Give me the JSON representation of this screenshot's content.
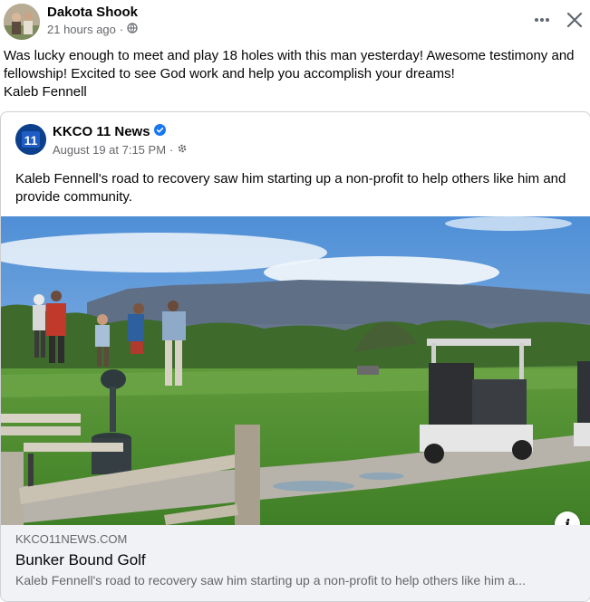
{
  "post": {
    "author": "Dakota Shook",
    "timestamp": "21 hours ago",
    "separator": "·",
    "privacy_icon": "globe-icon",
    "more_icon": "more-dots-icon",
    "close_icon": "close-icon",
    "text": "Was lucky enough to meet and play 18 holes with this man yesterday! Awesome testimony and fellowship! Excited to see God work and help you accomplish your dreams!\nKaleb Fennell"
  },
  "shared_post": {
    "page_name": "KKCO 11 News",
    "verified_icon": "verified-badge-icon",
    "verified_color": "#1877f2",
    "logo_text": "11",
    "timestamp": "August 19 at 7:15 PM",
    "separator": "·",
    "audience_icon": "gear-icon",
    "text": "Kaleb Fennell's road to recovery saw him starting up a non-profit to help others like him and provide community."
  },
  "link_preview": {
    "domain": "KKCO11NEWS.COM",
    "title": "Bunker Bound Golf",
    "description": "Kaleb Fennell's road to recovery saw him starting up a non-profit to help others like him a...",
    "info_icon": "info-icon",
    "info_label": "i"
  }
}
